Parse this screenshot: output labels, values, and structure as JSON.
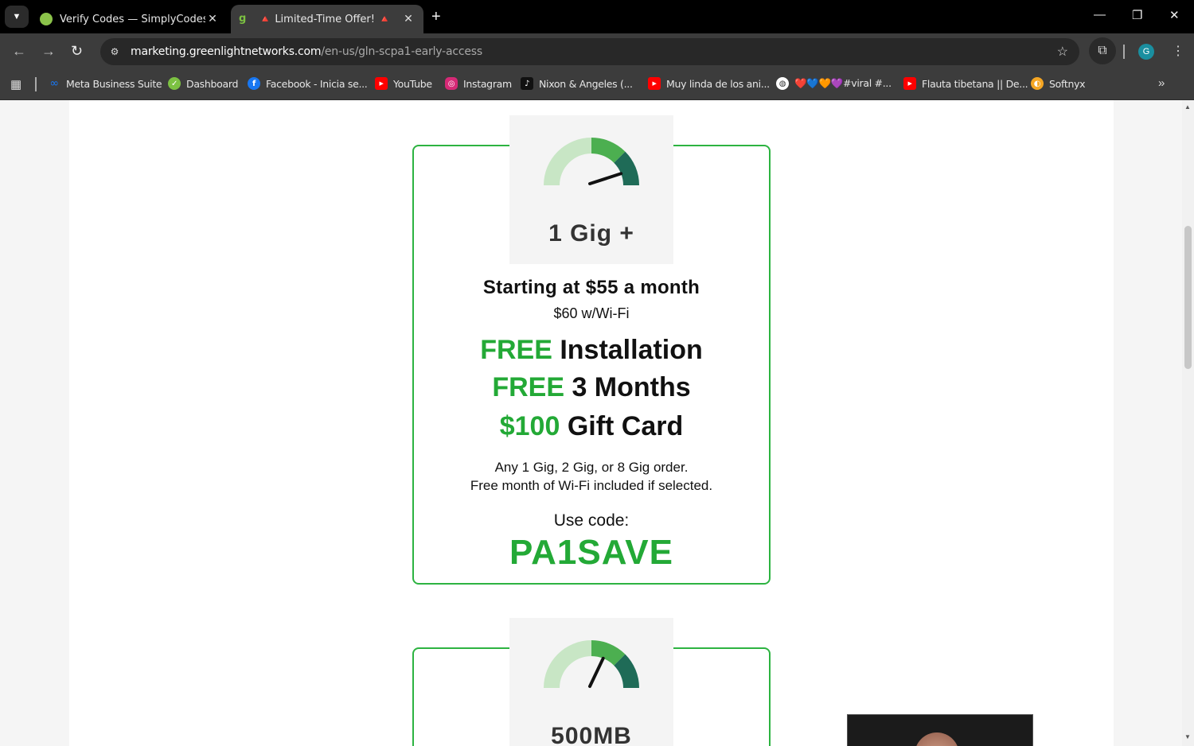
{
  "browser": {
    "tabs": [
      {
        "title": "Verify Codes — SimplyCodes",
        "active": false,
        "favicon": "simplycodes-icon"
      },
      {
        "title": "🔺 Limited-Time Offer! 🔺",
        "active": true,
        "favicon": "greenlight-icon"
      }
    ],
    "url_host": "marketing.greenlightnetworks.com",
    "url_path": "/en-us/gln-scpa1-early-access",
    "profile_initial": "G",
    "bookmarks": [
      {
        "label": "Meta Business Suite",
        "icon": "meta-icon",
        "color": "#1877f2"
      },
      {
        "label": "Dashboard",
        "icon": "dashboard-icon",
        "color": "#7cc142"
      },
      {
        "label": "Facebook - Inicia se...",
        "icon": "facebook-icon",
        "color": "#1877f2"
      },
      {
        "label": "YouTube",
        "icon": "youtube-icon",
        "color": "#ff0000"
      },
      {
        "label": "Instagram",
        "icon": "instagram-icon",
        "color": "#d62976"
      },
      {
        "label": "Nixon & Angeles (...",
        "icon": "tiktok-icon",
        "color": "#111111"
      },
      {
        "label": "Muy linda de los ani...",
        "icon": "youtube-icon",
        "color": "#ff0000"
      },
      {
        "label": "❤️💙🧡💜#viral #...",
        "icon": "globe-icon",
        "color": "#ffffff"
      },
      {
        "label": "Flauta tibetana || De...",
        "icon": "youtube-icon",
        "color": "#ff0000"
      },
      {
        "label": "Softnyx",
        "icon": "softnyx-icon",
        "color": "#f5a623"
      }
    ]
  },
  "plans": [
    {
      "speed": "1 Gig +",
      "gauge_level": 0.88,
      "price": "Starting at $55 a month",
      "wifi_price": "$60 w/Wi-Fi",
      "offers": [
        {
          "highlight": "FREE",
          "text": "Installation"
        },
        {
          "highlight": "FREE",
          "text": "3 Months"
        },
        {
          "highlight": "$100",
          "text": "Gift Card"
        }
      ],
      "note_line1": "Any 1 Gig, 2 Gig, or 8 Gig order.",
      "note_line2": "Free month of Wi-Fi included if selected.",
      "code_label": "Use code:",
      "code": "PA1SAVE"
    },
    {
      "speed": "500MB",
      "gauge_level": 0.62
    }
  ],
  "colors": {
    "brand_green": "#23a936",
    "card_border": "#2db341",
    "gauge_light": "#c8e6c5",
    "gauge_mid": "#4caf50",
    "gauge_dark": "#1f6b57"
  }
}
